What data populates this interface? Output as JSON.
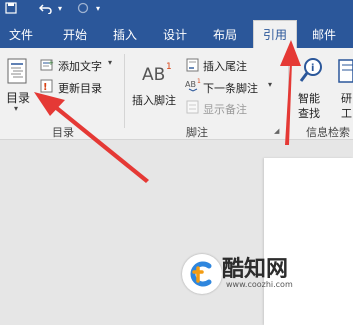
{
  "tabs": {
    "file": "文件",
    "home": "开始",
    "insert": "插入",
    "design": "设计",
    "layout": "布局",
    "references": "引用",
    "mailings": "邮件"
  },
  "ribbon": {
    "toc": {
      "toc_button": "目录",
      "add_text": "添加文字",
      "update_table": "更新目录",
      "group_label": "目录"
    },
    "footnotes": {
      "insert_footnote": "插入脚注",
      "insert_endnote": "插入尾注",
      "next_footnote": "下一条脚注",
      "show_notes": "显示备注",
      "group_label": "脚注",
      "ab_glyph": "AB",
      "ab_sup": "1"
    },
    "research": {
      "smart_lookup_line1": "智能",
      "smart_lookup_line2": "查找",
      "researcher_line1": "研",
      "researcher_line2": "工",
      "group_label": "信息检索"
    }
  },
  "watermark": {
    "title": "酷知网",
    "url": "www.coozhi.com"
  },
  "colors": {
    "ribbon_blue": "#2b579a",
    "arrow_red": "#e53935"
  }
}
